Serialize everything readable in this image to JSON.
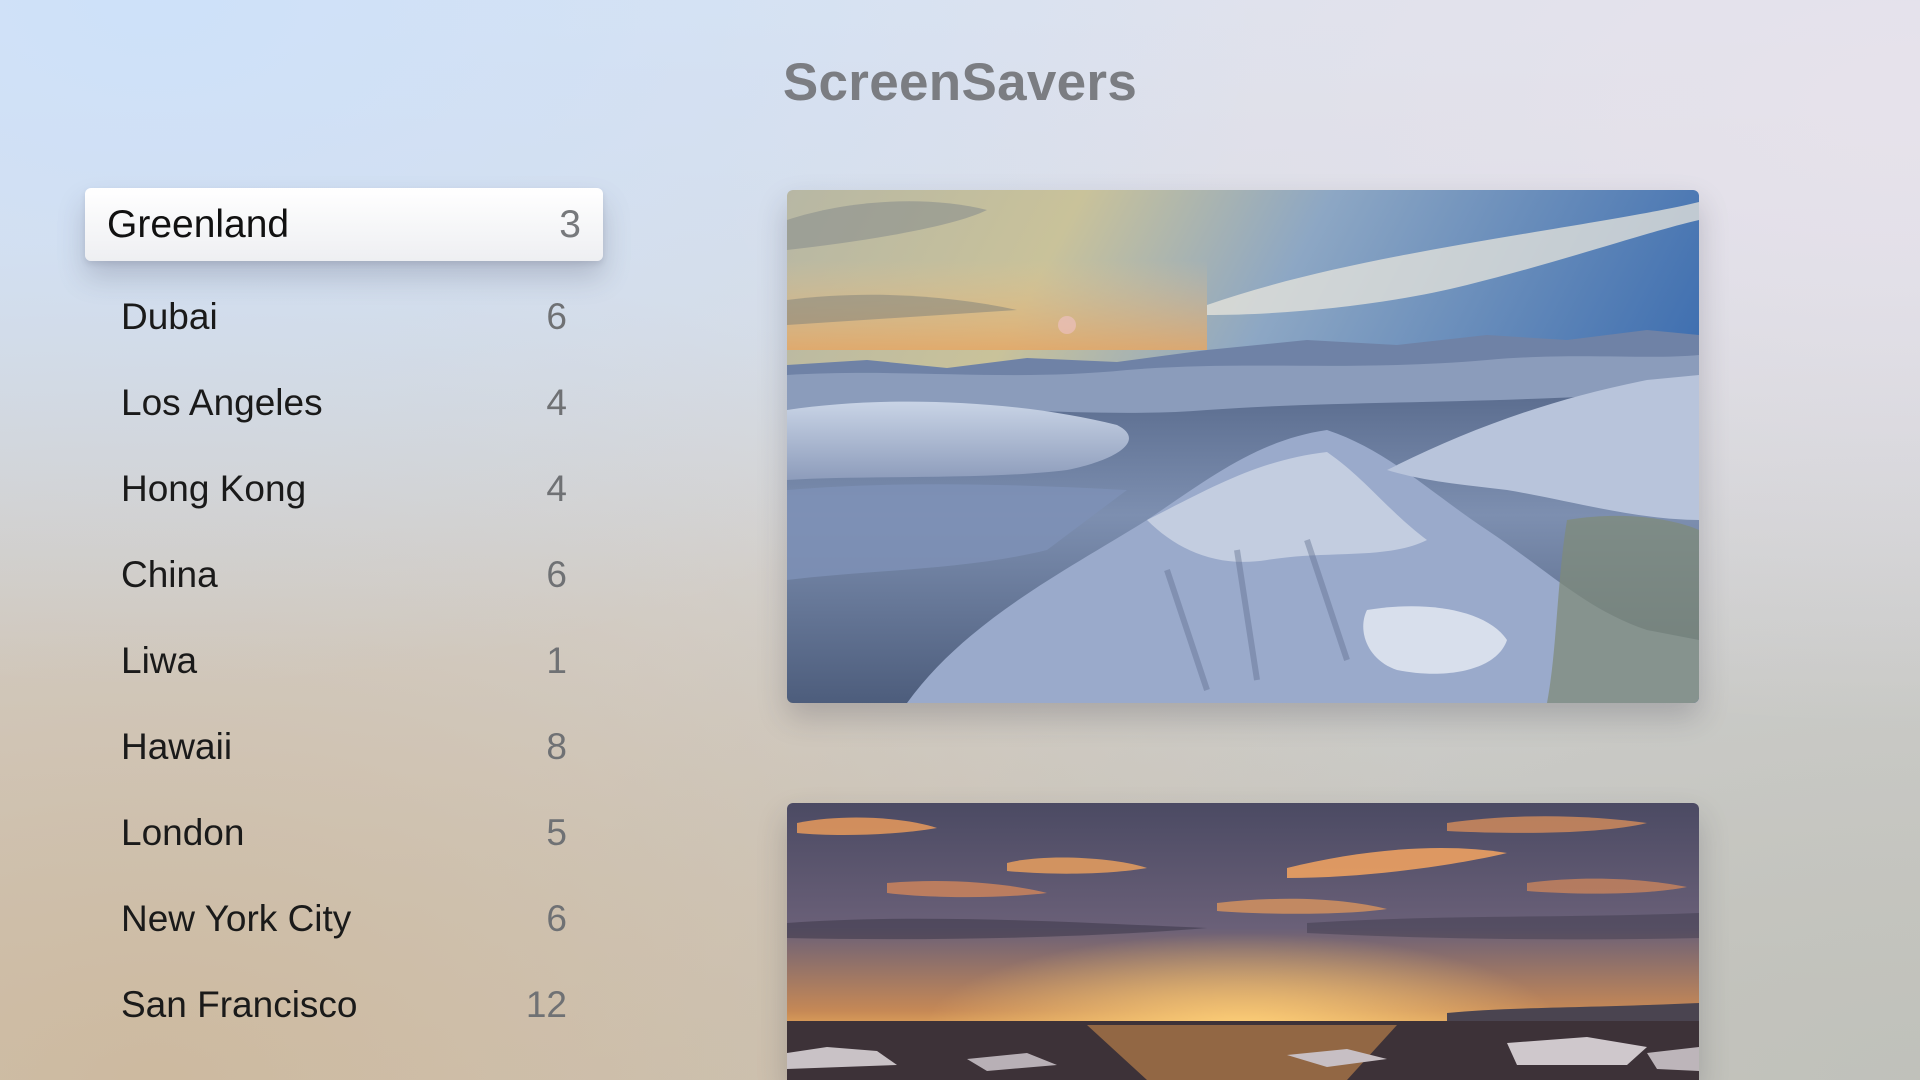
{
  "title": "ScreenSavers",
  "locations": [
    {
      "name": "Greenland",
      "count": "3",
      "selected": true
    },
    {
      "name": "Dubai",
      "count": "6"
    },
    {
      "name": "Los Angeles",
      "count": "4"
    },
    {
      "name": "Hong Kong",
      "count": "4"
    },
    {
      "name": "China",
      "count": "6"
    },
    {
      "name": "Liwa",
      "count": "1"
    },
    {
      "name": "Hawaii",
      "count": "8"
    },
    {
      "name": "London",
      "count": "5"
    },
    {
      "name": "New York City",
      "count": "6"
    },
    {
      "name": "San Francisco",
      "count": "12"
    }
  ],
  "previews": [
    {
      "icon": "greenland-snowy-mountains-image"
    },
    {
      "icon": "greenland-sunset-icebergs-image"
    }
  ]
}
